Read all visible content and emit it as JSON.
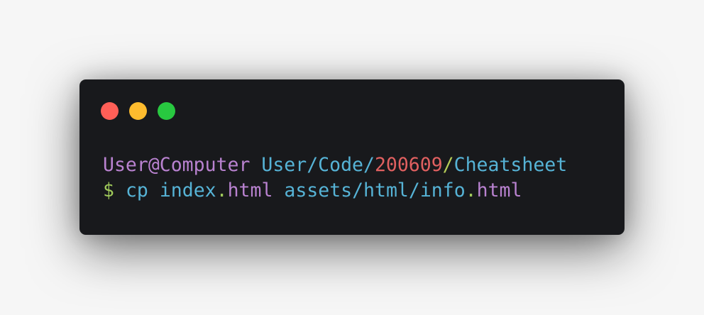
{
  "colors": {
    "close": "#ff5f57",
    "minimize": "#febc2e",
    "maximize": "#28c840",
    "user": "#b982d0",
    "path": "#56b3d6",
    "year": "#e06060",
    "slash": "#b5cc57",
    "prompt": "#9fc95a",
    "command": "#56b3d6",
    "extension": "#b982d0",
    "dot": "#9fc95a"
  },
  "window_controls": [
    "close",
    "minimize",
    "maximize"
  ],
  "prompt_line": {
    "user": "User@Computer",
    "sep": " ",
    "path_start": "User/Code/",
    "path_number": "200609",
    "path_slash": "/",
    "path_end": "Cheatsheet"
  },
  "command_line": {
    "prompt": "$",
    "sp1": " ",
    "cmd": "cp",
    "sp2": " ",
    "file1_name": "index",
    "file1_dot": ".",
    "file1_ext": "html",
    "sp3": " ",
    "file2_path": "assets/html/info",
    "file2_dot": ".",
    "file2_ext": "html"
  }
}
